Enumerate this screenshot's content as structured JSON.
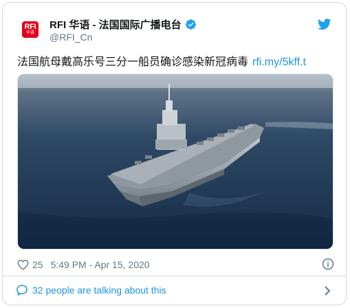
{
  "tweet": {
    "account_name": "RFI 华语 - 法国国际广播电台",
    "handle": "@RFI_Cn",
    "avatar_text": "RFI",
    "avatar_subtext": "华语",
    "text": "法国航母戴高乐号三分一船员确诊感染新冠病毒",
    "link": "rfi.my/5kff.t",
    "likes": "25",
    "timestamp": "5:49 PM - Apr 15, 2020",
    "talking": "32 people are talking about this",
    "image_alt": "aircraft-carrier-photo"
  },
  "colors": {
    "link_blue": "#1b95e0",
    "muted": "#657786",
    "text": "#14171a",
    "border": "#cfd9de",
    "brand_red": "#e2001a"
  },
  "icons": [
    "verified-badge-icon",
    "twitter-bird-icon",
    "heart-icon",
    "info-icon",
    "speech-bubble-icon",
    "chevron-right-icon"
  ]
}
